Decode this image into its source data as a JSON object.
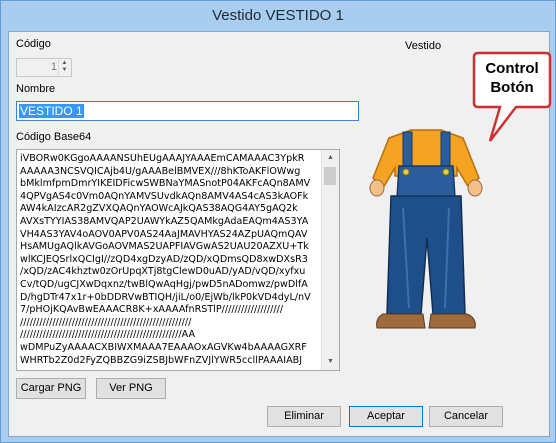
{
  "window": {
    "title": "Vestido VESTIDO 1"
  },
  "form": {
    "codigo_label": "Código",
    "codigo_value": "1",
    "nombre_label": "Nombre",
    "nombre_value": "VESTIDO 1",
    "base64_label": "Código Base64",
    "base64_value": "iVBORw0KGgoAAAANSUhEUgAAAJYAAAEmCAMAAAC3YpkR\nAAAAA3NCSVQICAjb4U/gAAABelBMVEX///8hKToAKFlOWwg\nbMklmfpmDmrYIKEIDFicwSWBNaYMASnotP04AKFcAQn8AMV\n4QPVgAS4c0Vm0AQnYAMVSUvdkAQn8AMV4AS4cAS3kAOFk\nAW4kAIzcAR2gZVXQAQnYAOWcAJkQAS38AQG4AY5gAQ2k\nAVXsTYYIAS38AMVQAP2UAWYkAZ5QAMkgAdaEAQm4AS3YA\nVH4AS3YAV4oAOV0APV0AS24AaJMAVHYAS24AZpUAQmQAV\nHsAMUgAQlkAVGoAOVMAS2UAPFIAVGwAS2UAU20AZXU+Tk\nwlKCJEQSrlxQCIgI//zQD4xgDzyAD/zQD/xQDmsQD8xwDXsR3\n/xQD/zAC4khztw0zOrUpqXTj8tgClewD0uAD/yAD/vQD/xyfxu\nCv/tQD/ugCJXwDqxnz/twBlQwAqHgj/pwD5nADomwz/pwDlfA\nD/hgDTr47x1r+0bDDRVwBTIQH/jiL/o0/EjWb/lkP0kVD4dyL/nV\n7/pHOjKQAvBwEAAACR8K+xAAAAfnRSTlP///////////////////\n/////////////////////////////////////////////////////\n//////////////////////////////////////////////////AA\nwDMPuZyAAAACXBIWXMAAA7EAAAOxAGVKw4bAAAAGXRF\nWHRTb2Z0d2FyZQBBZG9iZSBJbWFnZVJlYWR5ccllPAAAIABJ"
  },
  "buttons": {
    "cargar_png": "Cargar PNG",
    "ver_png": "Ver PNG",
    "eliminar": "Eliminar",
    "aceptar": "Aceptar",
    "cancelar": "Cancelar"
  },
  "preview": {
    "label": "Vestido",
    "image_description": "overalls-figure",
    "callout": "Control\nBotón"
  },
  "colors": {
    "title_bar": "#a9cdee",
    "selection": "#3399ff",
    "callout_fill": "#ffffff",
    "callout_stroke": "#d03030",
    "overalls_blue": "#1e4f8a",
    "shirt_orange": "#f5a323"
  }
}
